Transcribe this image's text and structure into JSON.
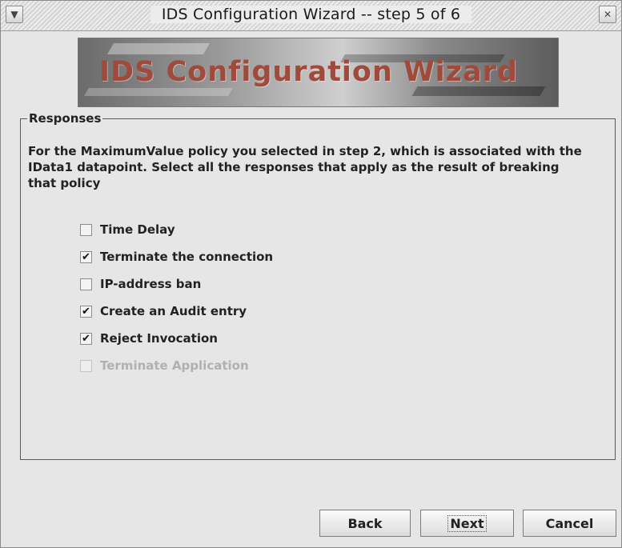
{
  "window": {
    "title": "IDS Configuration Wizard -- step 5 of 6",
    "menu_icon": "chevron-down-icon",
    "close_icon": "close-icon"
  },
  "banner": {
    "text": "IDS Configuration Wizard",
    "text_color": "#a04a3c"
  },
  "responses": {
    "legend": "Responses",
    "description": "For the MaximumValue policy you selected in step 2, which is associated with the IData1 datapoint. Select all the responses that apply as the result of breaking that policy",
    "options": [
      {
        "label": "Time Delay",
        "checked": false,
        "enabled": true
      },
      {
        "label": "Terminate the connection",
        "checked": true,
        "enabled": true
      },
      {
        "label": "IP-address ban",
        "checked": false,
        "enabled": true
      },
      {
        "label": "Create an Audit entry",
        "checked": true,
        "enabled": true
      },
      {
        "label": "Reject Invocation",
        "checked": true,
        "enabled": true
      },
      {
        "label": "Terminate Application",
        "checked": false,
        "enabled": false
      }
    ]
  },
  "buttons": {
    "back": "Back",
    "next": "Next",
    "cancel": "Cancel"
  }
}
